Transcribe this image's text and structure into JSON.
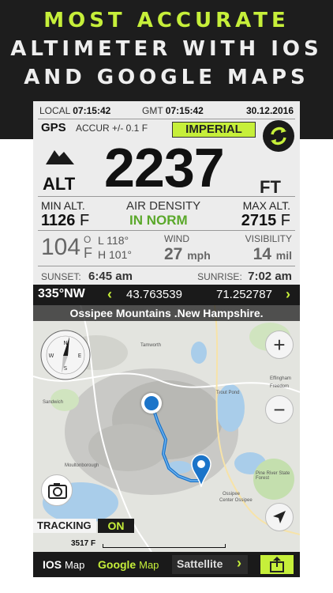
{
  "promo": {
    "line1": "MOST ACCURATE",
    "line2": "ALTIMETER WITH IOS",
    "line3": "AND GOOGLE MAPS"
  },
  "status": {
    "local_label": "LOCAL",
    "local_time": "07:15:42",
    "gmt_label": "GMT",
    "gmt_time": "07:15:42",
    "date": "30.12.2016"
  },
  "gps": {
    "label": "GPS",
    "accuracy": "ACCUR +/- 0.1 F"
  },
  "units_button": "IMPERIAL",
  "altitude": {
    "label": "ALT",
    "value": "2237",
    "unit": "FT"
  },
  "min_alt": {
    "label": "MIN ALT.",
    "value": "1126",
    "unit": "F"
  },
  "air_density": {
    "label": "AIR DENSITY",
    "value": "IN NORM"
  },
  "max_alt": {
    "label": "MAX ALT.",
    "value": "2715",
    "unit": "F"
  },
  "temperature": {
    "value": "104",
    "deg": "O",
    "unit": "F",
    "low": "L 118°",
    "high": "H 101°"
  },
  "wind": {
    "label": "WIND",
    "value": "27",
    "unit": "mph"
  },
  "visibility": {
    "label": "VISIBILITY",
    "value": "14",
    "unit": "mil"
  },
  "sun": {
    "sunset_label": "SUNSET:",
    "sunset": "6:45 am",
    "sunrise_label": "SUNRISE:",
    "sunrise": "7:02 am"
  },
  "coords": {
    "heading": "335°NW",
    "lat": "43.763539",
    "lon": "71.252787"
  },
  "map": {
    "location_title": "Ossipee Mountains .New Hampshire.",
    "tracking_label": "TRACKING",
    "tracking_state": "ON",
    "scale_label": "3517 F",
    "labels": [
      "Tamworth",
      "Sandwich",
      "Moultonborough",
      "Trout Pond",
      "Effingham",
      "Freedom",
      "Pine River State Forest",
      "Ossipee",
      "Center Ossipee"
    ]
  },
  "bottom": {
    "ios_bold": "IOS",
    "ios_rest": "Map",
    "google_bold": "Google",
    "google_rest": "Map",
    "satellite": "Sattellite"
  },
  "colors": {
    "accent": "#c6ef3a",
    "air_density_green": "#5aa82a",
    "route_blue": "#1b74c9"
  }
}
